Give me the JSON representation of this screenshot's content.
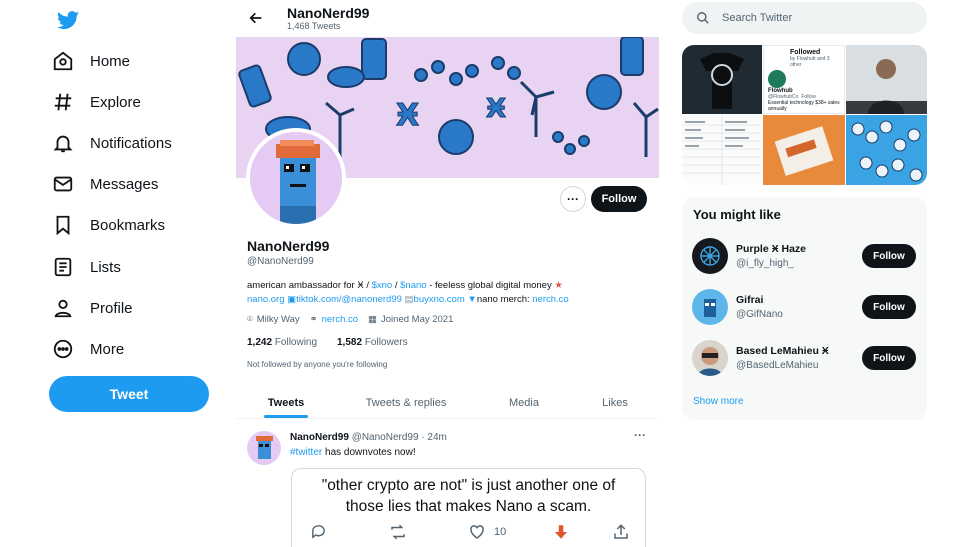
{
  "nav": {
    "items": [
      {
        "label": "Home",
        "icon": "home-icon"
      },
      {
        "label": "Explore",
        "icon": "hashtag-icon"
      },
      {
        "label": "Notifications",
        "icon": "bell-icon"
      },
      {
        "label": "Messages",
        "icon": "envelope-icon"
      },
      {
        "label": "Bookmarks",
        "icon": "bookmark-icon"
      },
      {
        "label": "Lists",
        "icon": "list-icon"
      },
      {
        "label": "Profile",
        "icon": "person-icon"
      },
      {
        "label": "More",
        "icon": "more-circle-icon"
      }
    ],
    "tweet_label": "Tweet"
  },
  "header": {
    "name": "NanoNerd99",
    "tweet_count": "1,468 Tweets"
  },
  "profile": {
    "name": "NanoNerd99",
    "handle": "@NanoNerd99",
    "follow_label": "Follow",
    "bio": {
      "line1_prefix": "american ambassador for Ӿ / ",
      "tag1": "$xno",
      "sep": " / ",
      "tag2": "$nano",
      "line1_suffix": " - feeless global digital money",
      "link1": "nano.org",
      "link2": "tiktok.com/@nanonerd99",
      "link3": "buyxno.com",
      "merch_text": "nano merch: ",
      "link4": "nerch.co"
    },
    "location": "Milky Way",
    "website": "nerch.co",
    "joined": "Joined May 2021",
    "following_count": "1,242",
    "following_label": "Following",
    "followers_count": "1,582",
    "followers_label": "Followers",
    "not_followed": "Not followed by anyone you're following"
  },
  "tabs": [
    "Tweets",
    "Tweets & replies",
    "Media",
    "Likes"
  ],
  "tweet": {
    "name": "NanoNerd99",
    "handle": "@NanoNerd99",
    "time": "· 24m",
    "hashtag": "#twitter",
    "text": " has downvotes now!",
    "quote_text": "\"other crypto are not\" is just another one of those lies that makes Nano a scam.",
    "likes": "10"
  },
  "search": {
    "placeholder": "Search Twitter"
  },
  "mosaic": {
    "followed_title": "Followed",
    "followed_by": "by Flowhub and 3 other",
    "account_name": "Flowhub",
    "account_handle": "@FlowhubCo",
    "follow_mini": "Follow",
    "desc": "Essential technology $38+ sales annually"
  },
  "you_might_like": {
    "title": "You might like",
    "accounts": [
      {
        "name": "Purple Ӿ Haze",
        "handle": "@i_fly_high_",
        "follow": "Follow"
      },
      {
        "name": "Gifrai",
        "handle": "@GifNano",
        "follow": "Follow"
      },
      {
        "name": "Based LeMahieu Ӿ",
        "handle": "@BasedLeMahieu",
        "follow": "Follow"
      }
    ],
    "show_more": "Show more"
  },
  "colors": {
    "accent": "#1d9bf0",
    "text": "#0f1419",
    "muted": "#536471",
    "banner": "#e8d3f2"
  }
}
